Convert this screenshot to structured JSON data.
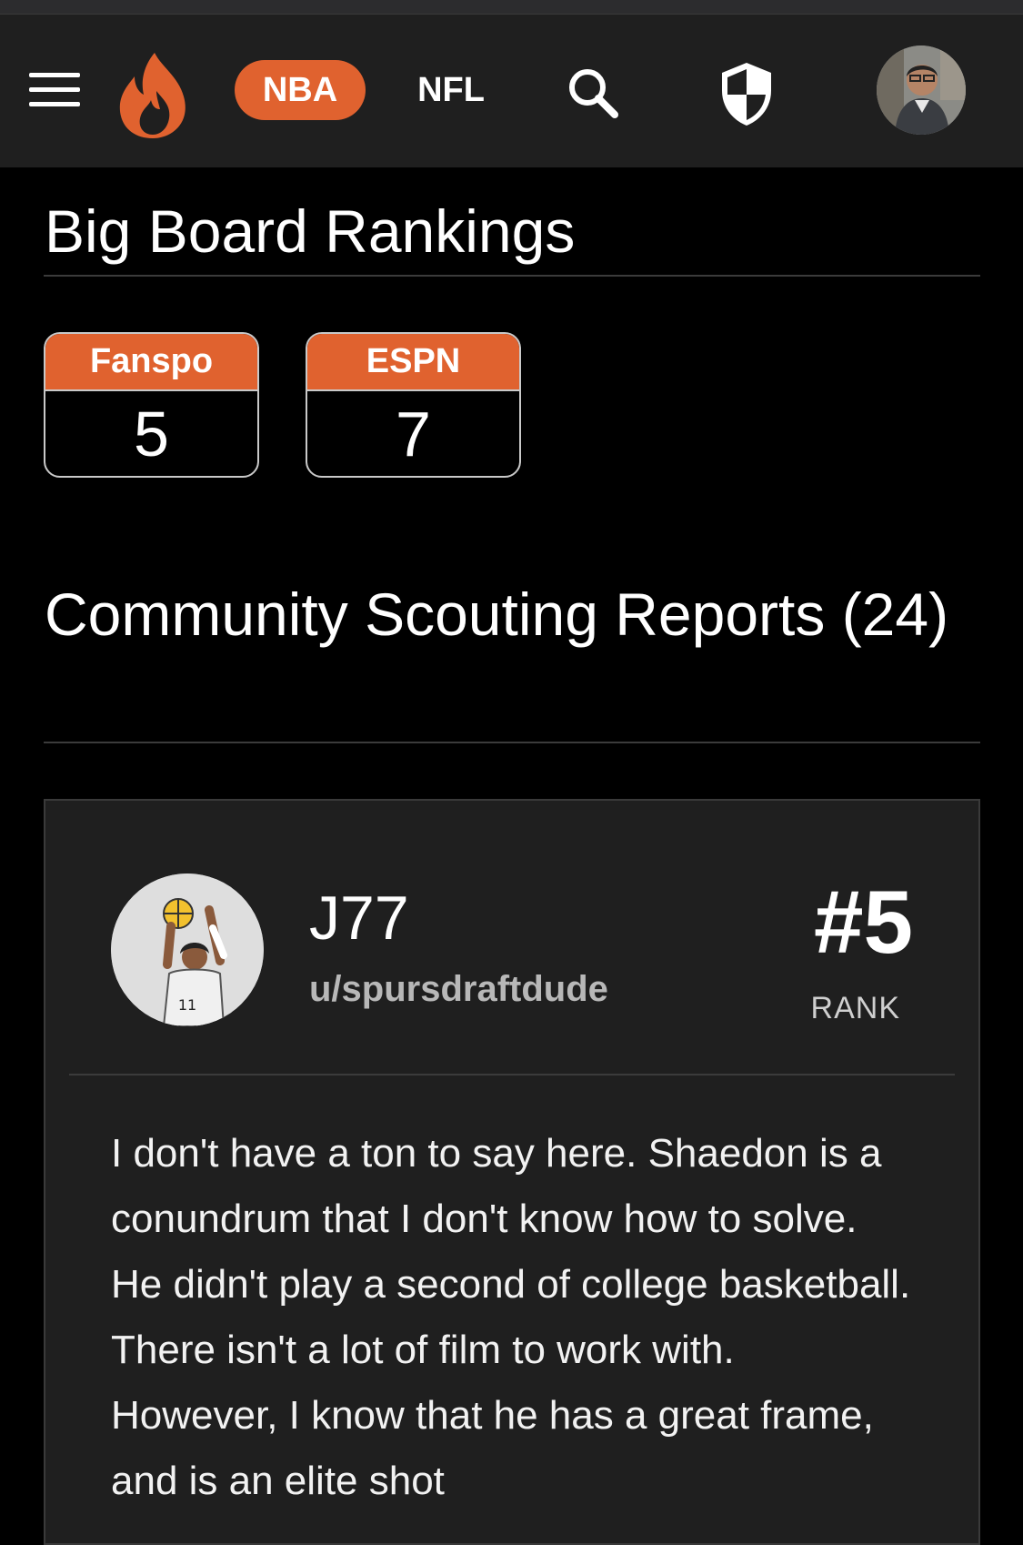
{
  "nav": {
    "leagues": [
      {
        "label": "NBA",
        "active": true
      },
      {
        "label": "NFL",
        "active": false
      }
    ],
    "icons": [
      "menu-icon",
      "flame-logo-icon",
      "search-icon",
      "shield-icon",
      "avatar"
    ],
    "accent_color": "#e0622f"
  },
  "big_board": {
    "title": "Big Board Rankings",
    "rankings": [
      {
        "source": "Fanspo",
        "rank": "5"
      },
      {
        "source": "ESPN",
        "rank": "7"
      }
    ]
  },
  "community": {
    "title": "Community Scouting Reports (24)",
    "report": {
      "title": "J77",
      "username": "u/spursdraftdude",
      "rank": "#5",
      "rank_label": "RANK",
      "body": "I don't have a ton to say here. Shaedon is a conundrum that I don't know how to solve. He didn't play a second of college basketball. There isn't a lot of film to work with. However, I know that he has a great frame, and is an elite shot"
    }
  }
}
